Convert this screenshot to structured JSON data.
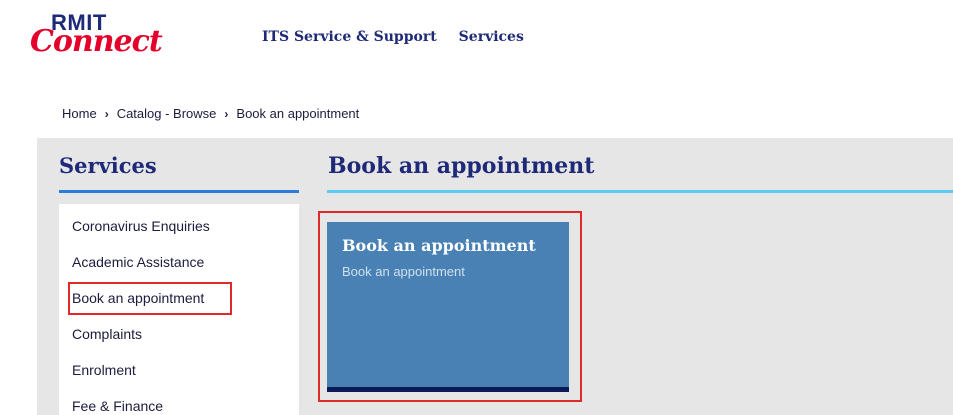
{
  "header": {
    "logo_top": "RMIT",
    "logo_bottom": "Connect",
    "nav": [
      {
        "label": "ITS Service & Support"
      },
      {
        "label": "Services"
      }
    ]
  },
  "breadcrumb": {
    "items": [
      "Home",
      "Catalog - Browse",
      "Book an appointment"
    ],
    "separator": "›"
  },
  "sidebar": {
    "title": "Services",
    "items": [
      {
        "label": "Coronavirus Enquiries"
      },
      {
        "label": "Academic Assistance"
      },
      {
        "label": "Book an appointment"
      },
      {
        "label": "Complaints"
      },
      {
        "label": "Enrolment"
      },
      {
        "label": "Fee & Finance"
      }
    ]
  },
  "content": {
    "title": "Book an appointment",
    "cards": [
      {
        "title": "Book an appointment",
        "subtitle": "Book an appointment"
      }
    ]
  },
  "colors": {
    "brand_navy": "#1e2a78",
    "brand_red": "#e5002b",
    "card_blue": "#4a81b4",
    "highlight_red": "#e02a2a"
  }
}
